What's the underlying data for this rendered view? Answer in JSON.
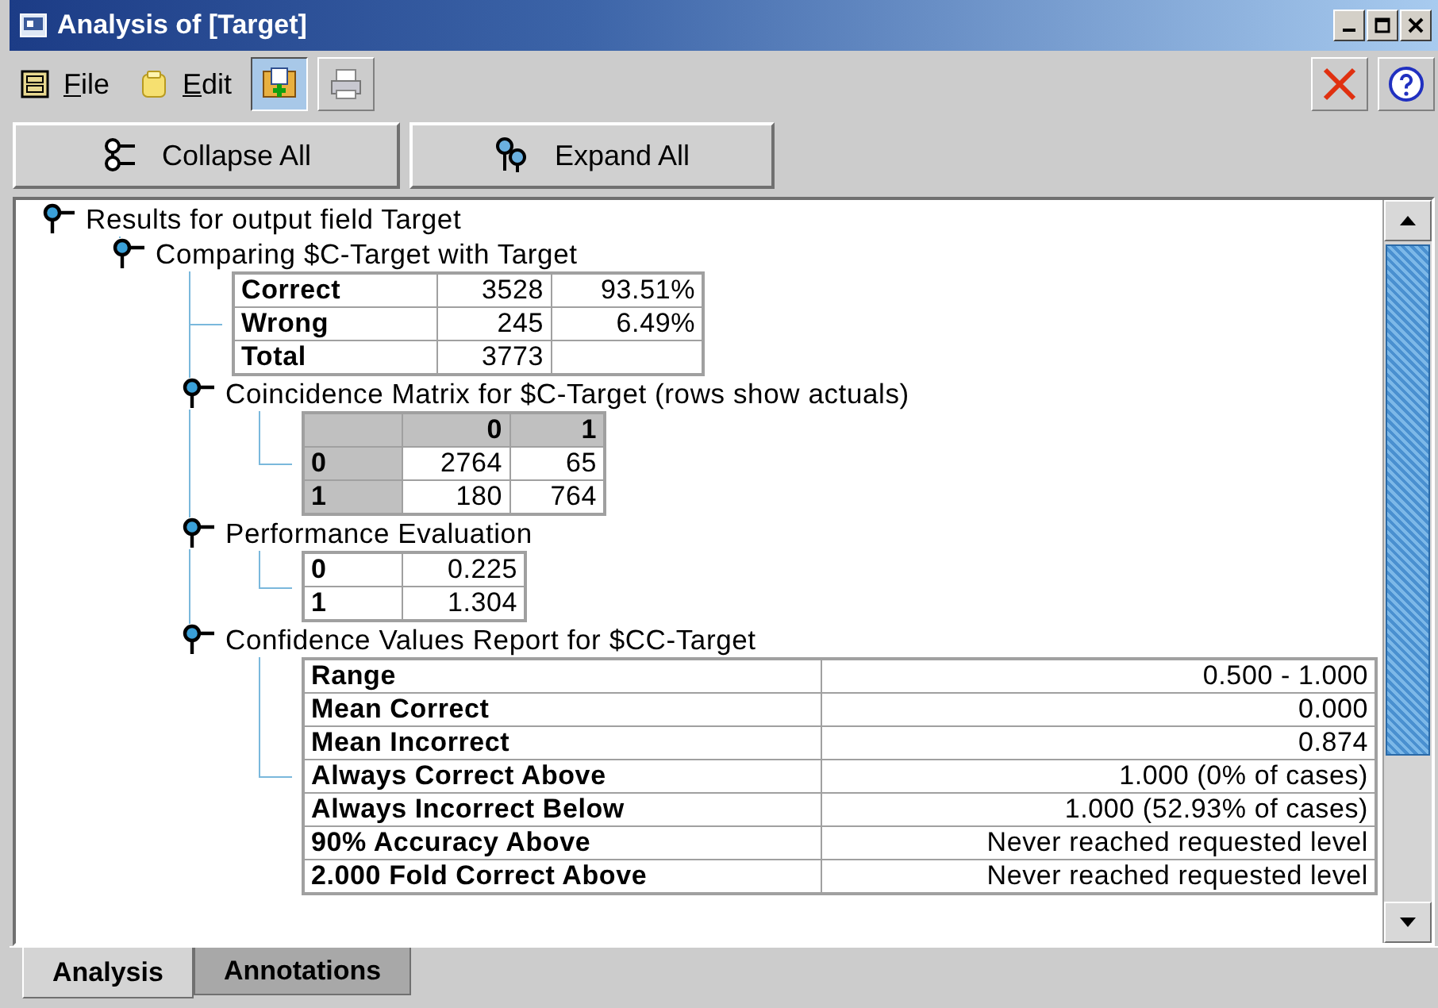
{
  "window": {
    "title": "Analysis of [Target]"
  },
  "menu": [
    {
      "label": "File"
    },
    {
      "label": "Edit"
    }
  ],
  "toolbar": [
    {
      "selected": true
    },
    {
      "selected": false
    }
  ],
  "buttons": [
    {
      "label": "Collapse All"
    },
    {
      "label": "Expand All"
    }
  ],
  "tree": {
    "label": "Results for output field Target",
    "children": [
      {
        "label": "Comparing $C-Target with Target",
        "children": [
          {
            "kind": "table",
            "table": {
              "kind": "summary",
              "rows": [
                {
                  "label": "Correct",
                  "cells": [
                    "3528",
                    "93.51%"
                  ]
                },
                {
                  "label": "Wrong",
                  "cells": [
                    "245",
                    "6.49%"
                  ]
                },
                {
                  "label": "Total",
                  "cells": [
                    "3773"
                  ]
                }
              ]
            }
          },
          {
            "label": "Coincidence Matrix for $C-Target (rows show actuals)",
            "children": [
              {
                "kind": "table",
                "table": {
                  "kind": "matrix",
                  "columns": [
                    "0",
                    "1"
                  ],
                  "rows": [
                    {
                      "label": "0",
                      "cells": [
                        "2764",
                        "65"
                      ]
                    },
                    {
                      "label": "1",
                      "cells": [
                        "180",
                        "764"
                      ]
                    }
                  ]
                }
              }
            ]
          },
          {
            "label": "Performance Evaluation",
            "children": [
              {
                "kind": "table",
                "table": {
                  "kind": "evaluation",
                  "rows": [
                    {
                      "label": "0",
                      "cells": [
                        "0.225"
                      ]
                    },
                    {
                      "label": "1",
                      "cells": [
                        "1.304"
                      ]
                    }
                  ]
                }
              }
            ]
          },
          {
            "label": "Confidence Values Report for $CC-Target",
            "children": [
              {
                "kind": "table",
                "table": {
                  "kind": "report",
                  "rows": [
                    {
                      "label": "Range",
                      "cells": [
                        "0.500 - 1.000"
                      ]
                    },
                    {
                      "label": "Mean Correct",
                      "cells": [
                        "0.000"
                      ]
                    },
                    {
                      "label": "Mean Incorrect",
                      "cells": [
                        "0.874"
                      ]
                    },
                    {
                      "label": "Always Correct Above",
                      "cells": [
                        "1.000 (0% of cases)"
                      ]
                    },
                    {
                      "label": "Always Incorrect Below",
                      "cells": [
                        "1.000 (52.93% of cases)"
                      ]
                    },
                    {
                      "label": "90% Accuracy Above",
                      "cells": [
                        "Never reached requested level"
                      ]
                    },
                    {
                      "label": "2.000 Fold Correct Above",
                      "cells": [
                        "Never reached requested level"
                      ]
                    }
                  ]
                }
              }
            ]
          }
        ]
      }
    ]
  },
  "tabs": [
    {
      "label": "Analysis",
      "selected": true
    },
    {
      "label": "Annotations",
      "selected": false
    }
  ]
}
